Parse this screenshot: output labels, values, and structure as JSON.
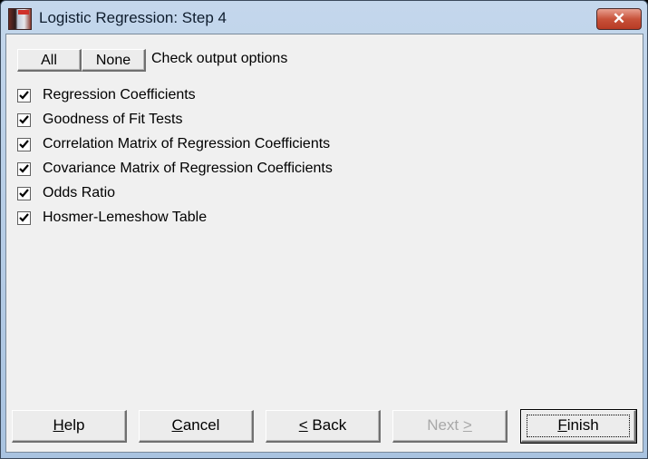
{
  "window": {
    "title": "Logistic Regression: Step 4",
    "close_icon": "close-x-icon",
    "app_icon": "app-icon"
  },
  "toolbar": {
    "all_label": "All",
    "none_label": "None",
    "hint": "Check output options"
  },
  "options": [
    {
      "label": "Regression Coefficients",
      "checked": true
    },
    {
      "label": "Goodness of Fit Tests",
      "checked": true
    },
    {
      "label": "Correlation Matrix of Regression Coefficients",
      "checked": true
    },
    {
      "label": "Covariance Matrix of Regression Coefficients",
      "checked": true
    },
    {
      "label": "Odds Ratio",
      "checked": true
    },
    {
      "label": "Hosmer-Lemeshow Table",
      "checked": true
    }
  ],
  "footer": {
    "help": {
      "mnemonic": "H",
      "rest": "elp"
    },
    "cancel": {
      "mnemonic": "C",
      "rest": "ancel"
    },
    "back": {
      "mnemonic": "<",
      "rest": " Back"
    },
    "next": {
      "pre": "Next ",
      "mnemonic": ">",
      "enabled": false
    },
    "finish": {
      "mnemonic": "F",
      "rest": "inish",
      "default": true
    }
  }
}
